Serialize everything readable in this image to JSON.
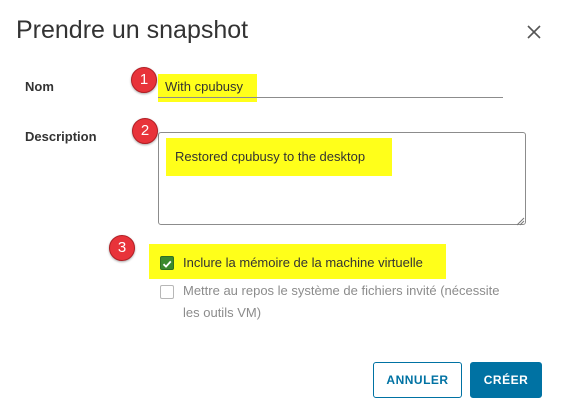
{
  "dialog": {
    "title": "Prendre un snapshot",
    "close_icon": "close-icon"
  },
  "form": {
    "name_label": "Nom",
    "name_value": "With cpubusy",
    "description_label": "Description",
    "description_value": "Restored cpubusy to the desktop"
  },
  "options": {
    "include_memory": {
      "label": "Inclure la mémoire de la machine virtuelle",
      "checked": true
    },
    "quiesce": {
      "label_line1": "Mettre au repos le système de fichiers invité (nécessite",
      "label_line2": "les outils VM)",
      "checked": false,
      "disabled": true
    }
  },
  "annotations": [
    "1",
    "2",
    "3"
  ],
  "buttons": {
    "cancel": "ANNULER",
    "create": "CRÉER"
  },
  "colors": {
    "highlight": "#ffff1a",
    "badge": "#e8333a",
    "primary": "#0072a3",
    "checkbox_checked": "#3c8a2e"
  }
}
